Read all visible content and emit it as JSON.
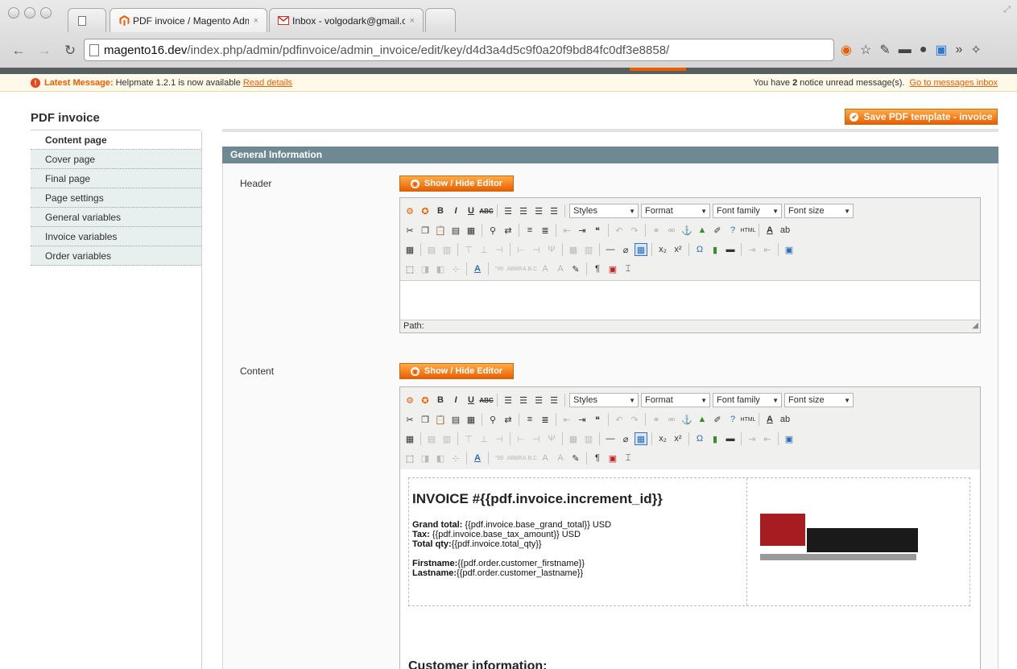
{
  "browser": {
    "tabs": [
      {
        "label": "PDF invoice / Magento Admi",
        "close": "×",
        "favicon": "magento-icon"
      },
      {
        "label": "Inbox - volgodark@gmail.co",
        "close": "×",
        "favicon": "gmail-icon"
      }
    ],
    "url_host": "magento16.dev",
    "url_path": "/index.php/admin/pdfinvoice/admin_invoice/edit/key/d4d3a4d5c9f0a20f9bd84fc0df3e8858/"
  },
  "message": {
    "prefix": "Latest Message:",
    "text": "Helpmate 1.2.1 is now available",
    "link": "Read details",
    "right_prefix": "You have",
    "right_count": "2",
    "right_suffix": "notice unread message(s).",
    "right_link": "Go to messages inbox"
  },
  "sidebar": {
    "title": "PDF invoice",
    "items": [
      {
        "label": "Content page",
        "active": true
      },
      {
        "label": "Cover page"
      },
      {
        "label": "Final page"
      },
      {
        "label": "Page settings"
      },
      {
        "label": "General variables"
      },
      {
        "label": "Invoice variables"
      },
      {
        "label": "Order variables"
      }
    ]
  },
  "main": {
    "save_label": "Save PDF template - invoice",
    "fieldset_title": "General Information",
    "header_label": "Header",
    "content_label": "Content",
    "showhide_label": "Show / Hide Editor",
    "path_label": "Path:"
  },
  "editor_selects": {
    "styles": "Styles",
    "format": "Format",
    "font_family": "Font family",
    "font_size": "Font size"
  },
  "template": {
    "title": "INVOICE #{{pdf.invoice.increment_id}}",
    "grand_total_label": "Grand total:",
    "grand_total_value": "{{pdf.invoice.base_grand_total}} USD",
    "tax_label": "Tax:",
    "tax_value": "{{pdf.invoice.base_tax_amount}} USD",
    "total_qty_label": "Total qty:",
    "total_qty_value": "{{pdf.invoice.total_qty}}",
    "firstname_label": "Firstname:",
    "firstname_value": "{{pdf.order.customer_firstname}}",
    "lastname_label": "Lastname:",
    "lastname_value": "{{pdf.order.customer_lastname}}",
    "customer_heading": "Customer information:"
  },
  "colors": {
    "accent": "#eb5e00",
    "fieldset_header": "#6f8992",
    "sidebar_bg": "#e7efef",
    "logo_red": "#a61c20",
    "logo_black": "#1a1a1a"
  }
}
